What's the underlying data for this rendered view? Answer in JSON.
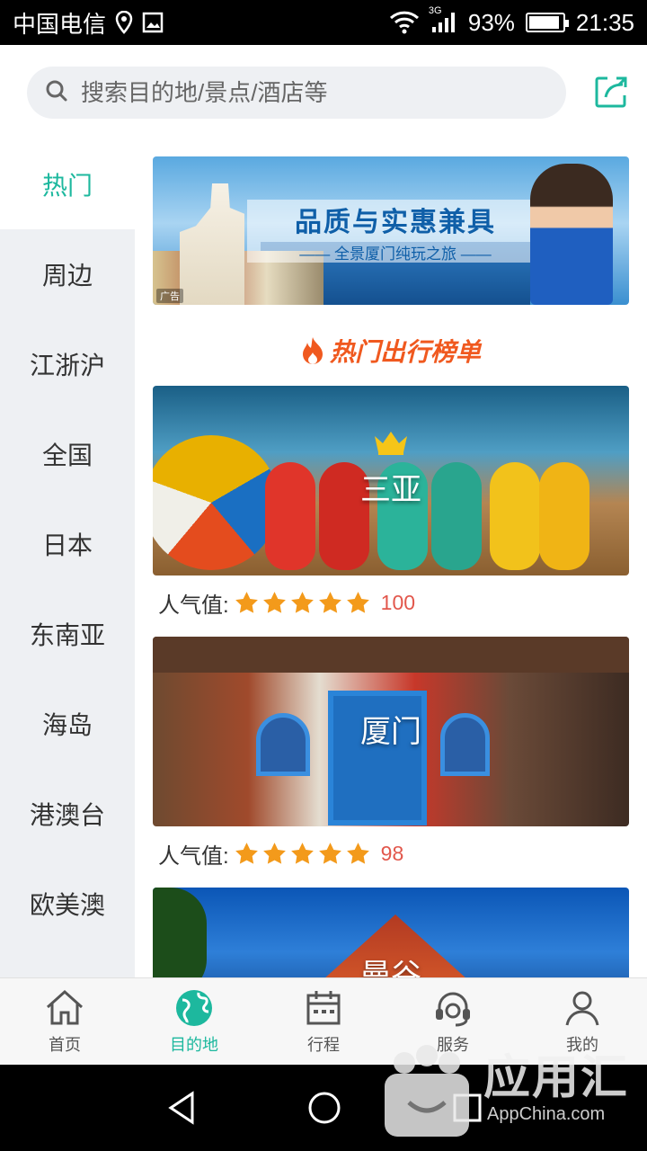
{
  "status_bar": {
    "carrier": "中国电信",
    "network": "3G",
    "battery": "93%",
    "battery_level": 0.93,
    "time": "21:35"
  },
  "search": {
    "placeholder": "搜索目的地/景点/酒店等"
  },
  "sidebar": {
    "items": [
      {
        "label": "热门",
        "active": true
      },
      {
        "label": "周边",
        "active": false
      },
      {
        "label": "江浙沪",
        "active": false
      },
      {
        "label": "全国",
        "active": false
      },
      {
        "label": "日本",
        "active": false
      },
      {
        "label": "东南亚",
        "active": false
      },
      {
        "label": "海岛",
        "active": false
      },
      {
        "label": "港澳台",
        "active": false
      },
      {
        "label": "欧美澳",
        "active": false
      }
    ]
  },
  "banner": {
    "headline": "品质与实惠兼具",
    "subline": "—— 全景厦门纯玩之旅 ——",
    "ad_tag": "广告"
  },
  "section": {
    "title": "热门出行榜单"
  },
  "destinations": [
    {
      "name": "三亚",
      "rating_label": "人气值:",
      "stars": 5,
      "score": "100"
    },
    {
      "name": "厦门",
      "rating_label": "人气值:",
      "stars": 5,
      "score": "98"
    },
    {
      "name": "曼谷"
    }
  ],
  "bottom_nav": {
    "items": [
      {
        "label": "首页",
        "icon": "home-icon",
        "active": false
      },
      {
        "label": "目的地",
        "icon": "globe-icon",
        "active": true
      },
      {
        "label": "行程",
        "icon": "calendar-icon",
        "active": false
      },
      {
        "label": "服务",
        "icon": "headset-icon",
        "active": false
      },
      {
        "label": "我的",
        "icon": "user-icon",
        "active": false
      }
    ]
  },
  "watermark": {
    "title": "应用汇",
    "subtitle": "AppChina.com"
  },
  "colors": {
    "accent": "#1db89e",
    "section_title": "#f0591f",
    "score": "#e2574c",
    "star": "#f39a1b",
    "sidebar_bg": "#eef0f3"
  }
}
